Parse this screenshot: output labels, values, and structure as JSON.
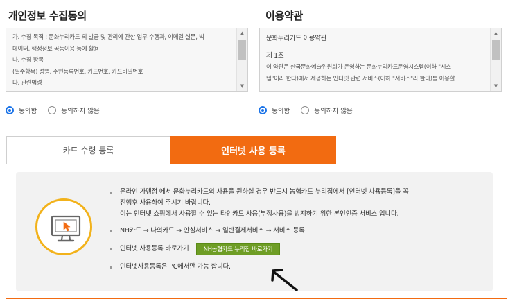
{
  "privacy": {
    "title": "개인정보 수집동의",
    "lines": [
      "가. 수집 목적 : 문화누리카드 의 발급 및 관리에 관한 업무 수행과, 이메일 설문, 빅",
      "데이터, 행정정보 공동이용 등에 활용",
      "나. 수집 항목",
      "(필수항목) 성명, 주민등록번호, 카드번호, 카드비밀번호",
      "다. 관련법령"
    ],
    "agree_label": "동의함",
    "disagree_label": "동의하지 않음"
  },
  "terms": {
    "title": "이용약관",
    "heading": "문화누리카드 이용약관",
    "article": "제 1조",
    "lines": [
      "이 약관은 한국문화예술위원회가 운영하는 문화누리카드운영시스템(이하 \"시스",
      "템\"이라 한다)에서 제공하는 인터넷 관련 서비스(이하 \"서비스\"라 한다)를 이용할"
    ],
    "agree_label": "동의함",
    "disagree_label": "동의하지 않음"
  },
  "tabs": {
    "card": "카드 수령 등록",
    "internet": "인터넷 사용 등록"
  },
  "info": {
    "b1_line1": "온라인 가맹점 에서 문화누리카드의 사용을 원하실 경우 반드시 농협카드 누리집에서 [인터넷 사용등록]을 꼭",
    "b1_line2": "진행후 사용하여 주시기 바랍니다.",
    "b1_line3": "이는 인터넷 쇼핑에서 사용할 수 있는 타인카드 사용(부정사용)을 방지하기 위한 본인인증 서비스 입니다.",
    "b2": "NH카드 → 나의카드 → 안심서비스 → 일반결제서비스 → 서비스 등록",
    "b3_label": "인터넷 사용등록 바로가기",
    "b3_button": "NH농협카드 누리집 바로가기",
    "b4": "인터넷사용등록은 PC에서만 가능 합니다."
  },
  "colors": {
    "accent": "#f26b11",
    "button_green": "#6e9d25",
    "icon_ring": "#f2b21b",
    "radio_blue": "#1a73e8"
  }
}
